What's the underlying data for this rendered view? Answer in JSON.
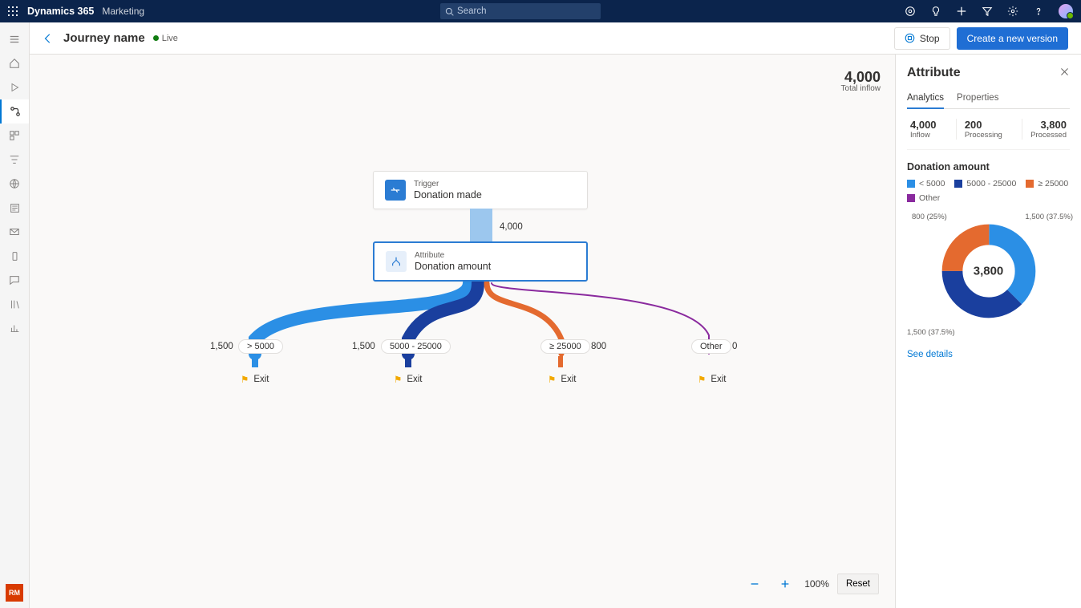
{
  "topbar": {
    "appName": "Dynamics 365",
    "area": "Marketing",
    "searchPlaceholder": "Search"
  },
  "header": {
    "title": "Journey name",
    "status": "Live",
    "stopLabel": "Stop",
    "createLabel": "Create a new version"
  },
  "canvas": {
    "totalInflowValue": "4,000",
    "totalInflowLabel": "Total inflow",
    "triggerKicker": "Trigger",
    "triggerTitle": "Donation made",
    "attributeKicker": "Attribute",
    "attributeTitle": "Donation amount",
    "edgeCount": "4,000",
    "branches": [
      {
        "count": "1,500",
        "label": "> 5000",
        "color": "#2b8fe5"
      },
      {
        "count": "1,500",
        "label": "5000 - 25000",
        "color": "#1a3f9e"
      },
      {
        "count": "800",
        "label": "≥ 25000",
        "color": "#e46a2f"
      },
      {
        "count": "0",
        "label": "Other",
        "color": "#8a2a9e"
      }
    ],
    "exitLabel": "Exit",
    "zoomLevel": "100%",
    "resetLabel": "Reset"
  },
  "panel": {
    "title": "Attribute",
    "tabs": {
      "analytics": "Analytics",
      "properties": "Properties"
    },
    "stats": {
      "inflowVal": "4,000",
      "inflowSub": "Inflow",
      "processingVal": "200",
      "processingSub": "Processing",
      "processedVal": "3,800",
      "processedSub": "Processed"
    },
    "sectionTitle": "Donation amount",
    "legend": [
      {
        "label": "< 5000",
        "color": "#2b8fe5"
      },
      {
        "label": "5000 - 25000",
        "color": "#1a3f9e"
      },
      {
        "label": "≥ 25000",
        "color": "#e46a2f"
      },
      {
        "label": "Other",
        "color": "#8a2a9e"
      }
    ],
    "donutCenter": "3,800",
    "donutLabels": {
      "nw": "800 (25%)",
      "ne": "1,500 (37.5%)",
      "sw": "1,500 (37.5%)"
    },
    "seeDetails": "See details"
  },
  "persona": "RM",
  "chart_data": {
    "type": "pie",
    "title": "Donation amount",
    "total": 3800,
    "series": [
      {
        "name": "< 5000",
        "value": 1500,
        "pct": 37.5,
        "color": "#2b8fe5"
      },
      {
        "name": "5000 - 25000",
        "value": 1500,
        "pct": 37.5,
        "color": "#1a3f9e"
      },
      {
        "name": "≥ 25000",
        "value": 800,
        "pct": 25.0,
        "color": "#e46a2f"
      },
      {
        "name": "Other",
        "value": 0,
        "pct": 0.0,
        "color": "#8a2a9e"
      }
    ]
  }
}
